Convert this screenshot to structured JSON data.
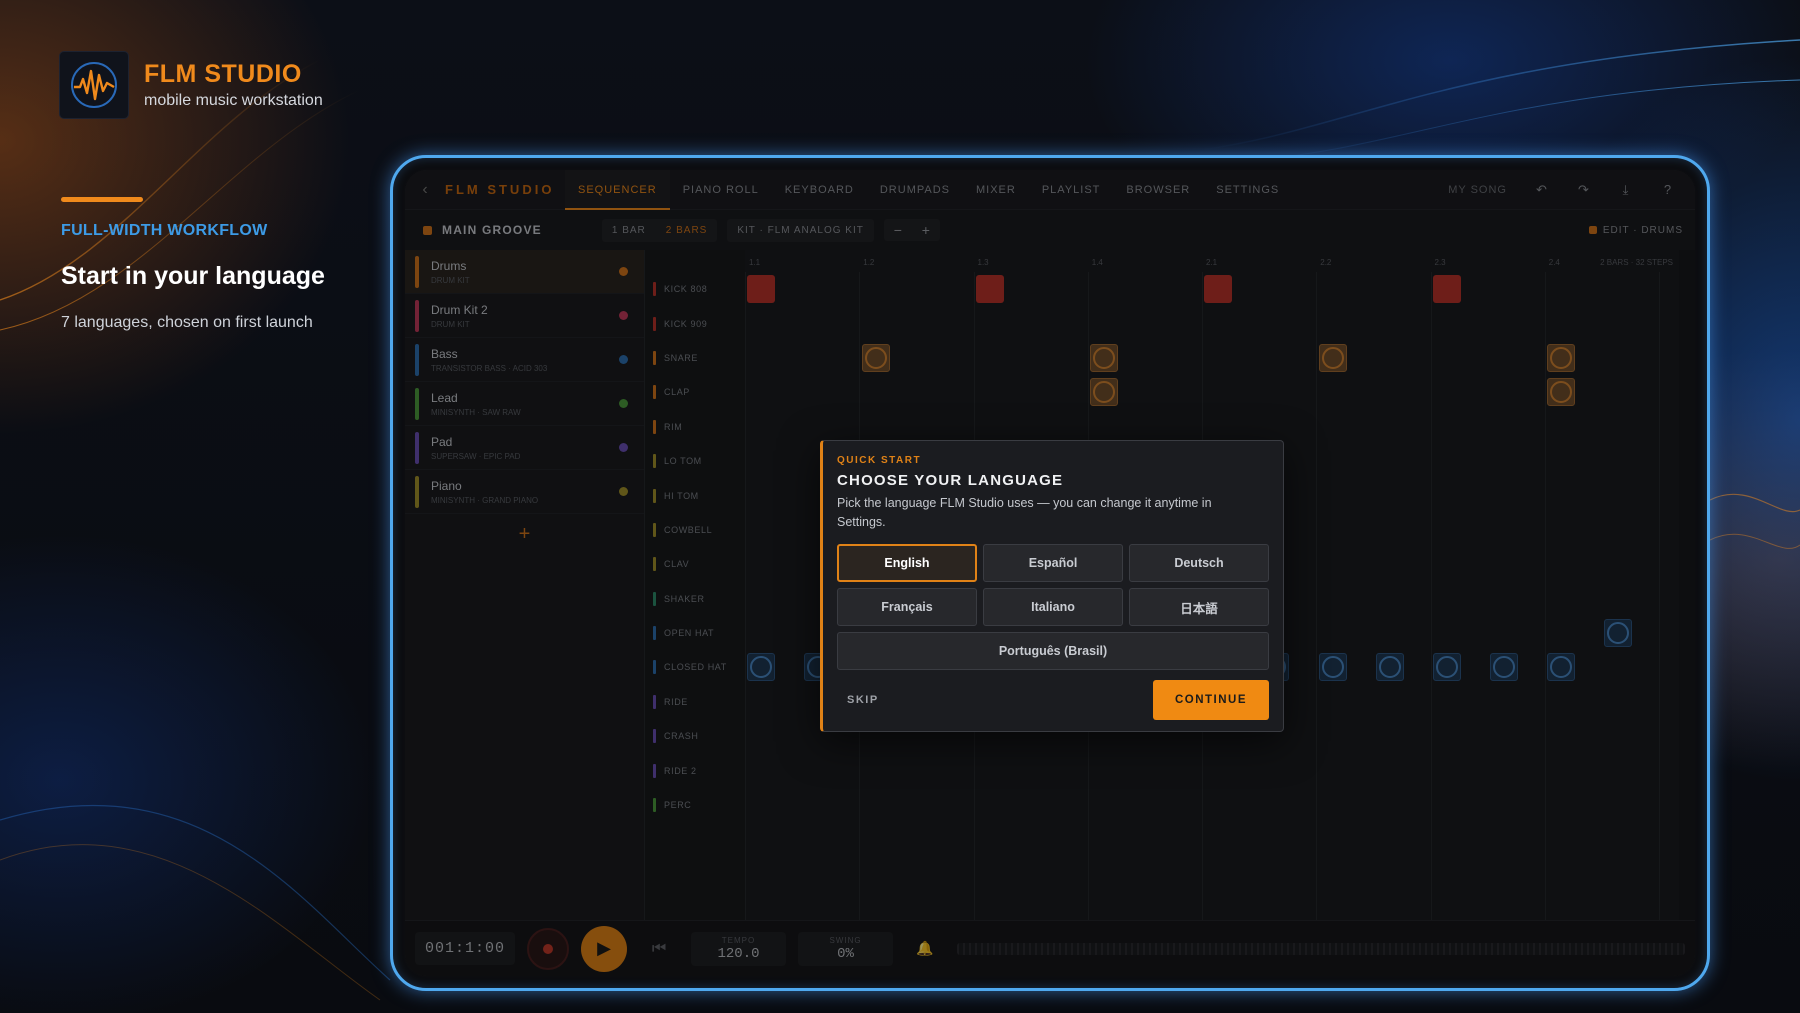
{
  "brand": {
    "title": "FLM STUDIO",
    "subtitle": "mobile music workstation"
  },
  "feature": {
    "tag": "FULL-WIDTH WORKFLOW",
    "headline": "Start in your language",
    "subline": "7 languages, chosen on first launch"
  },
  "app": {
    "name": "FLM STUDIO",
    "back_glyph": "‹",
    "tabs": [
      {
        "label": "SEQUENCER",
        "active": true
      },
      {
        "label": "PIANO ROLL"
      },
      {
        "label": "KEYBOARD"
      },
      {
        "label": "DRUMPADS"
      },
      {
        "label": "MIXER"
      },
      {
        "label": "PLAYLIST"
      },
      {
        "label": "BROWSER"
      },
      {
        "label": "SETTINGS"
      }
    ],
    "song_name": "MY SONG"
  },
  "subbar": {
    "pattern": "MAIN GROOVE",
    "length_options": [
      "1 BAR",
      "2 BARS"
    ],
    "length_selected": "2 BARS",
    "kit": "KIT · FLM ANALOG KIT",
    "minus": "−",
    "plus": "+",
    "edit_label": "EDIT · DRUMS"
  },
  "tracks": [
    {
      "name": "Drums",
      "sub": "DRUM KIT",
      "color": "#d0731b",
      "selected": true
    },
    {
      "name": "Drum Kit 2",
      "sub": "DRUM KIT",
      "color": "#c0395a"
    },
    {
      "name": "Bass",
      "sub": "TRANSISTOR BASS · ACID 303",
      "color": "#2e6fb0"
    },
    {
      "name": "Lead",
      "sub": "MINISYNTH · SAW RAW",
      "color": "#4c9a3c"
    },
    {
      "name": "Pad",
      "sub": "SUPERSAW · EPIC PAD",
      "color": "#6a4fb5"
    },
    {
      "name": "Piano",
      "sub": "MINISYNTH · GRAND PIANO",
      "color": "#a0902a"
    }
  ],
  "add_track": "+",
  "lanes": [
    {
      "name": "KICK 808",
      "color": "#b8332b"
    },
    {
      "name": "KICK 909",
      "color": "#b8332b"
    },
    {
      "name": "SNARE",
      "color": "#d0731b"
    },
    {
      "name": "CLAP",
      "color": "#d0731b"
    },
    {
      "name": "RIM",
      "color": "#d0731b"
    },
    {
      "name": "LO TOM",
      "color": "#a0902a"
    },
    {
      "name": "HI TOM",
      "color": "#a0902a"
    },
    {
      "name": "COWBELL",
      "color": "#a0902a"
    },
    {
      "name": "CLAV",
      "color": "#a0902a"
    },
    {
      "name": "SHAKER",
      "color": "#2e8a6a"
    },
    {
      "name": "OPEN HAT",
      "color": "#2e6fb0"
    },
    {
      "name": "CLOSED HAT",
      "color": "#2e6fb0"
    },
    {
      "name": "RIDE",
      "color": "#6a4fb5"
    },
    {
      "name": "CRASH",
      "color": "#6a4fb5"
    },
    {
      "name": "RIDE 2",
      "color": "#6a4fb5"
    },
    {
      "name": "PERC",
      "color": "#4c9a3c"
    }
  ],
  "grid_header": {
    "beats": [
      "1.1",
      "1.2",
      "1.3",
      "1.4",
      "2.1",
      "2.2",
      "2.3",
      "2.4"
    ],
    "info": "2 BARS · 32 STEPS"
  },
  "steps": {
    "count": 32,
    "kick": [
      0,
      8,
      16,
      24
    ],
    "snare": [
      4,
      12,
      20,
      28
    ],
    "clap": [
      12,
      28
    ],
    "open_hat": [
      30
    ],
    "closed_hat": [
      0,
      2,
      4,
      6,
      8,
      10,
      12,
      14,
      16,
      18,
      20,
      22,
      24,
      26,
      28
    ]
  },
  "transport": {
    "time": "001:1:00",
    "play_glyph": "▶",
    "rewind_glyph": "⏮",
    "tempo_label": "TEMPO",
    "tempo_value": "120.0",
    "swing_label": "SWING",
    "swing_value": "0%"
  },
  "modal": {
    "tag": "QUICK START",
    "title": "CHOOSE YOUR LANGUAGE",
    "description": "Pick the language FLM Studio uses — you can change it anytime in Settings.",
    "languages": [
      "English",
      "Español",
      "Deutsch",
      "Français",
      "Italiano",
      "日本語",
      "Português (Brasil)"
    ],
    "selected": "English",
    "skip_label": "SKIP",
    "continue_label": "CONTINUE"
  },
  "colors": {
    "accent": "#f08a1c",
    "feature_tag": "#3d9be6",
    "device_border": "#4fa8ee"
  }
}
